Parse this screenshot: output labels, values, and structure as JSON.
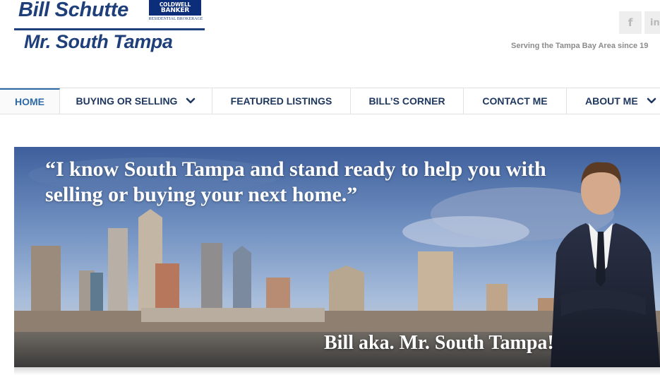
{
  "header": {
    "logo_name": "Bill Schutte",
    "logo_tagline": "Mr. South Tampa",
    "badge_line1": "COLDWELL",
    "badge_line2": "BANKER",
    "badge_sub": "RESIDENTIAL BROKERAGE",
    "tagline": "Serving the Tampa Bay Area since 19",
    "social": [
      {
        "icon": "facebook-icon",
        "glyph": "f"
      },
      {
        "icon": "linkedin-icon",
        "glyph": "in"
      }
    ]
  },
  "nav": {
    "items": [
      {
        "label": "HOME",
        "active": true
      },
      {
        "label": "BUYING OR SELLING",
        "has_dropdown": true
      },
      {
        "label": "FEATURED LISTINGS"
      },
      {
        "label": "BILL’S CORNER"
      },
      {
        "label": "CONTACT ME"
      },
      {
        "label": "ABOUT ME",
        "has_dropdown": true
      }
    ]
  },
  "hero": {
    "quote": "“I know South Tampa and stand ready to help you with selling or buying your next home.”",
    "caption": "Bill aka. Mr. South Tampa!"
  },
  "colors": {
    "brand_navy": "#1f3f7a",
    "nav_text": "#1f3860",
    "nav_active": "#2f6aa8",
    "tagline_gray": "#8b8b8b"
  }
}
